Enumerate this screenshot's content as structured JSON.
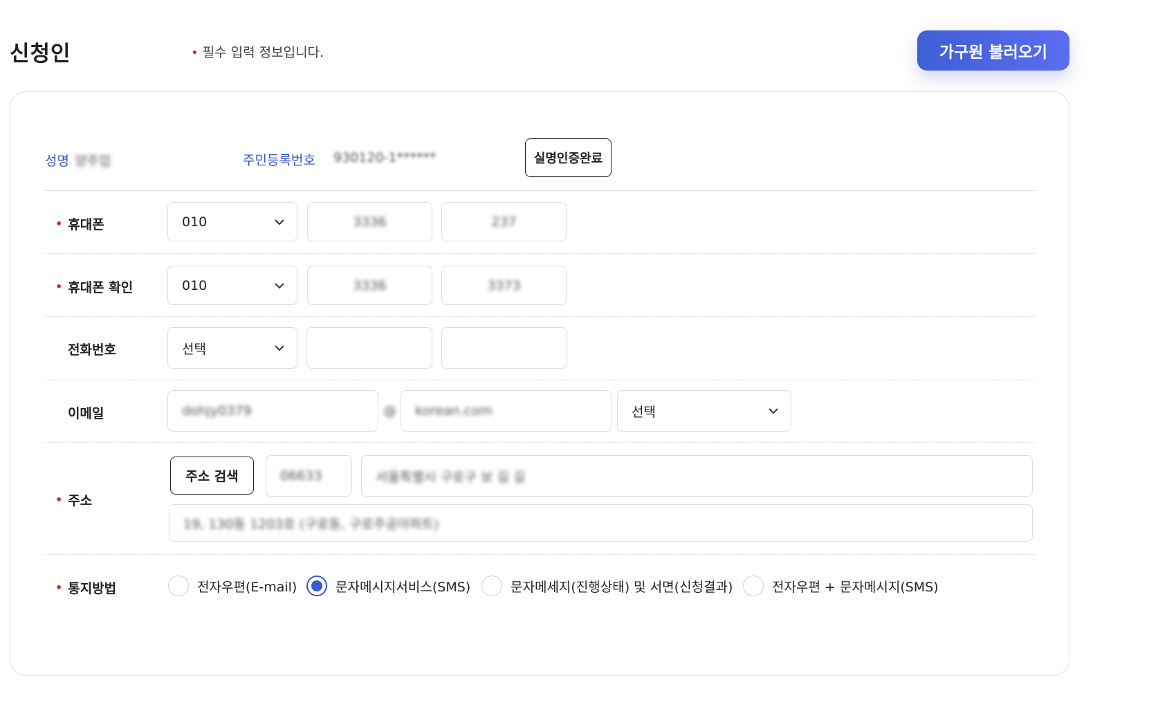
{
  "header": {
    "title": "신청인",
    "required_note": "필수 입력 정보입니다.",
    "load_button": "가구원 불러오기"
  },
  "applicant": {
    "name_label": "성명",
    "name_value": "양주업",
    "rrn_label": "주민등록번호",
    "rrn_value": "930120-1******",
    "verify_button": "실명인증완료"
  },
  "form": {
    "mobile": {
      "label": "휴대폰",
      "prefix": "010",
      "mid": "3336",
      "last": "237"
    },
    "mobile_confirm": {
      "label": "휴대폰 확인",
      "prefix": "010",
      "mid": "3336",
      "last": "3373"
    },
    "phone": {
      "label": "전화번호",
      "prefix": "선택",
      "mid": "",
      "last": ""
    },
    "email": {
      "label": "이메일",
      "local": "dohjy0379",
      "at": "@",
      "domain": "korean.com",
      "domain_select": "선택"
    },
    "address": {
      "label": "주소",
      "search_button": "주소 검색",
      "zipcode": "06633",
      "road": "서울특별시 구로구 보 길 길",
      "detail": "19, 130동 1203호 (구로동, 구로주공아파트)"
    },
    "notify": {
      "label": "통지방법",
      "options": [
        {
          "label": "전자우편(E-mail)",
          "selected": false
        },
        {
          "label": "문자메시지서비스(SMS)",
          "selected": true
        },
        {
          "label": "문자메세지(진행상태) 및 서면(신청결과)",
          "selected": false
        },
        {
          "label": "전자우편 + 문자메시지(SMS)",
          "selected": false
        }
      ]
    }
  },
  "colors": {
    "accent": "#3f5fd6",
    "required": "#e0242a",
    "label_blue": "#3558c8"
  }
}
